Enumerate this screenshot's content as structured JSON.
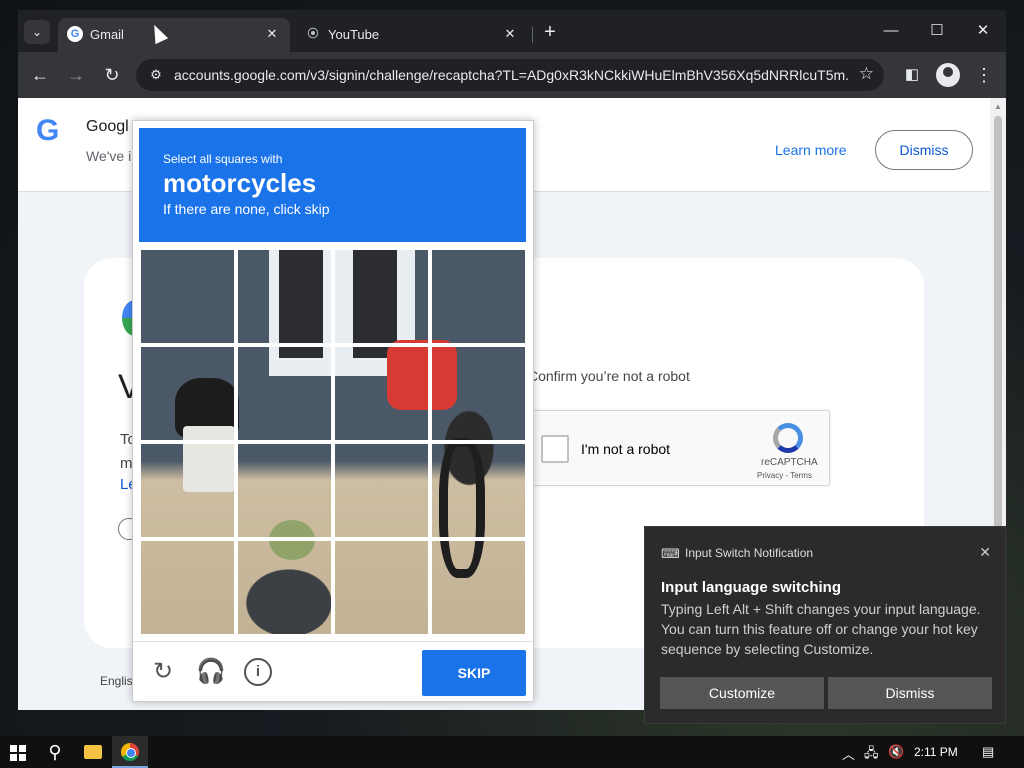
{
  "browser": {
    "tabs": [
      {
        "title": "Gmail",
        "favicon": "G"
      },
      {
        "title": "YouTube",
        "favicon": "⦿"
      }
    ],
    "url": "accounts.google.com/v3/signin/challenge/recaptcha?TL=ADg0xR3kNCkkiWHuElmBhV356Xq5dNRRlcuT5m..."
  },
  "page": {
    "banner_title": "Googl",
    "banner_sub": "We've i",
    "learn_more": "Learn more",
    "dismiss": "Dismiss",
    "card_big": "V",
    "card_desc_1": "To",
    "card_desc_2": "m",
    "card_link": "Le",
    "confirm": "Confirm you’re not a robot",
    "robot_label": "I'm not a robot",
    "recaptcha_name": "reCAPTCHA",
    "recaptcha_terms": "Privacy - Terms",
    "language": "Englis"
  },
  "captcha": {
    "instruction": "Select all squares with",
    "target": "motorcycles",
    "subtext": "If there are none, click skip",
    "skip": "SKIP"
  },
  "notification": {
    "header": "Input Switch Notification",
    "title": "Input language switching",
    "body": "Typing Left Alt + Shift changes your input language. You can turn this feature off or change your hot key sequence by selecting Customize.",
    "customize": "Customize",
    "dismiss": "Dismiss"
  },
  "taskbar": {
    "time": "2:11 PM"
  },
  "colors": {
    "captcha_blue": "#1a73e8",
    "tabstrip": "#202124",
    "toolbar": "#35363a"
  }
}
